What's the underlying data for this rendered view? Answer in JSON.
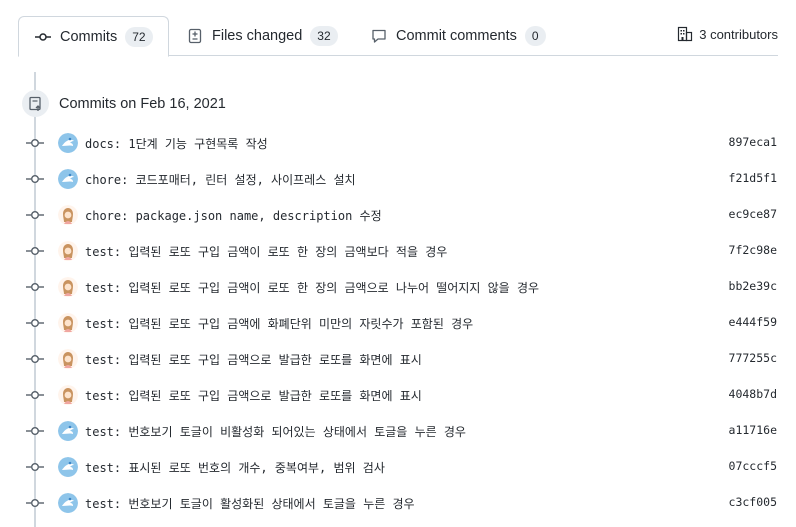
{
  "tabs": [
    {
      "label": "Commits",
      "count": "72",
      "icon": "commit-icon",
      "active": true
    },
    {
      "label": "Files changed",
      "count": "32",
      "icon": "file-diff-icon",
      "active": false
    },
    {
      "label": "Commit comments",
      "count": "0",
      "icon": "comment-icon",
      "active": false
    }
  ],
  "contributors": {
    "label": "3 contributors",
    "icon": "organization-icon"
  },
  "group": {
    "title": "Commits on Feb 16, 2021",
    "icon": "git-commit-group-icon"
  },
  "colors": {
    "border": "#d0d7de",
    "counter_bg": "#eaeef2",
    "text": "#24292f"
  },
  "commits": [
    {
      "message": "docs: 1단계 기능 구현목록 작성",
      "sha": "897eca1",
      "avatar": "avatar-a"
    },
    {
      "message": "chore: 코드포매터, 린터 설정, 사이프레스 설치",
      "sha": "f21d5f1",
      "avatar": "avatar-a"
    },
    {
      "message": "chore: package.json name, description 수정",
      "sha": "ec9ce87",
      "avatar": "avatar-b"
    },
    {
      "message": "test: 입력된 로또 구입 금액이 로또 한 장의 금액보다 적을 경우",
      "sha": "7f2c98e",
      "avatar": "avatar-b"
    },
    {
      "message": "test: 입력된 로또 구입 금액이 로또 한 장의 금액으로 나누어 떨어지지 않을 경우",
      "sha": "bb2e39c",
      "avatar": "avatar-b"
    },
    {
      "message": "test: 입력된 로또 구입 금액에 화폐단위 미만의 자릿수가 포함된 경우",
      "sha": "e444f59",
      "avatar": "avatar-b"
    },
    {
      "message": "test: 입력된 로또 구입 금액으로 발급한 로또를 화면에 표시",
      "sha": "777255c",
      "avatar": "avatar-b"
    },
    {
      "message": "test: 입력된 로또 구입 금액으로 발급한 로또를 화면에 표시",
      "sha": "4048b7d",
      "avatar": "avatar-b"
    },
    {
      "message": "test: 번호보기 토글이 비활성화 되어있는 상태에서 토글을 누른 경우",
      "sha": "a11716e",
      "avatar": "avatar-a"
    },
    {
      "message": "test: 표시된 로또 번호의 개수, 중복여부, 범위 검사",
      "sha": "07cccf5",
      "avatar": "avatar-a"
    },
    {
      "message": "test: 번호보기 토글이 활성화된 상태에서 토글을 누른 경우",
      "sha": "c3cf005",
      "avatar": "avatar-a"
    }
  ]
}
